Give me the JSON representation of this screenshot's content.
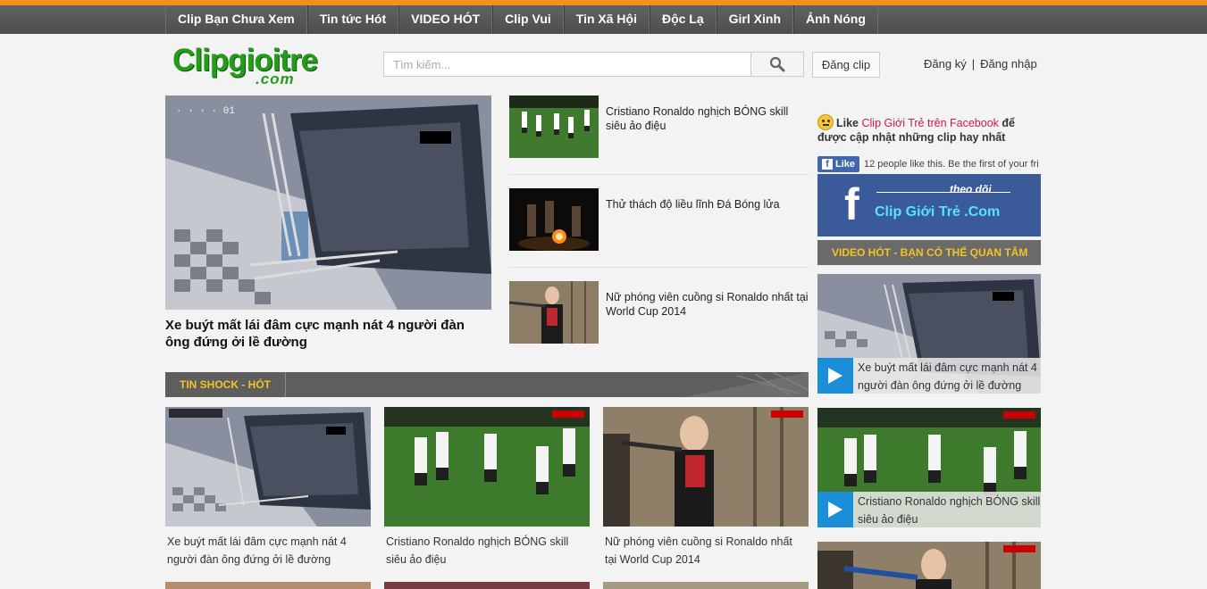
{
  "nav": {
    "items": [
      "Clip Bạn Chưa Xem",
      "Tin tức Hót",
      "VIDEO HÓT",
      "Clip Vui",
      "Tin Xã Hội",
      "Độc Lạ",
      "Girl Xinh",
      "Ảnh Nóng"
    ]
  },
  "header": {
    "logo_main": "Clipgioitre",
    "logo_sub": ".com",
    "search_placeholder": "Tìm kiếm...",
    "upload_label": "Đăng clip",
    "register_label": "Đăng ký",
    "auth_separator": "|",
    "login_label": "Đăng nhập"
  },
  "featured": {
    "title": "Xe buýt mất lái đâm cực mạnh nát 4 người đàn ông đứng ởi lề đường"
  },
  "side_list": [
    {
      "title": "Cristiano Ronaldo nghịch BÓNG skill siêu ảo điệu"
    },
    {
      "title": "Thử thách độ liều lĩnh Đá Bóng lửa"
    },
    {
      "title": "Nữ phóng viên cuồng si Ronaldo nhất tại World Cup 2014"
    }
  ],
  "section": {
    "title": "TIN SHOCK - HÓT"
  },
  "grid": [
    {
      "title": "Xe buýt mất lái đâm cực mạnh nát 4 người đàn ông đứng ởi lề đường"
    },
    {
      "title": "Cristiano Ronaldo nghịch BÓNG skill siêu ảo điệu"
    },
    {
      "title": "Nữ phóng viên cuồng si Ronaldo nhất tại World Cup 2014"
    }
  ],
  "facebook": {
    "like_word": "Like",
    "page_link": "Clip Giới Trẻ trên Facebook",
    "tail": "để được cập nhật những clip hay nhất",
    "like_button": "Like",
    "like_count_text": "12 people like this. Be the first of your fri",
    "banner_small": "theo dõi",
    "banner_big": "Clip Giới Trẻ .Com"
  },
  "right": {
    "header": "VIDEO HÓT - BẠN CÓ THỂ QUAN TÂM",
    "cards": [
      {
        "title": "Xe buýt mất lái đâm cực mạnh nát 4 người đàn ông đứng ởi lề đường"
      },
      {
        "title": "Cristiano Ronaldo nghịch BÓNG skill siêu ảo điệu"
      }
    ]
  },
  "colors": {
    "accent": "#f0901e",
    "logo_green": "#259b1b",
    "section_title": "#f3c324",
    "link_pink": "#d4145a",
    "play_blue": "#1a8ed8"
  }
}
